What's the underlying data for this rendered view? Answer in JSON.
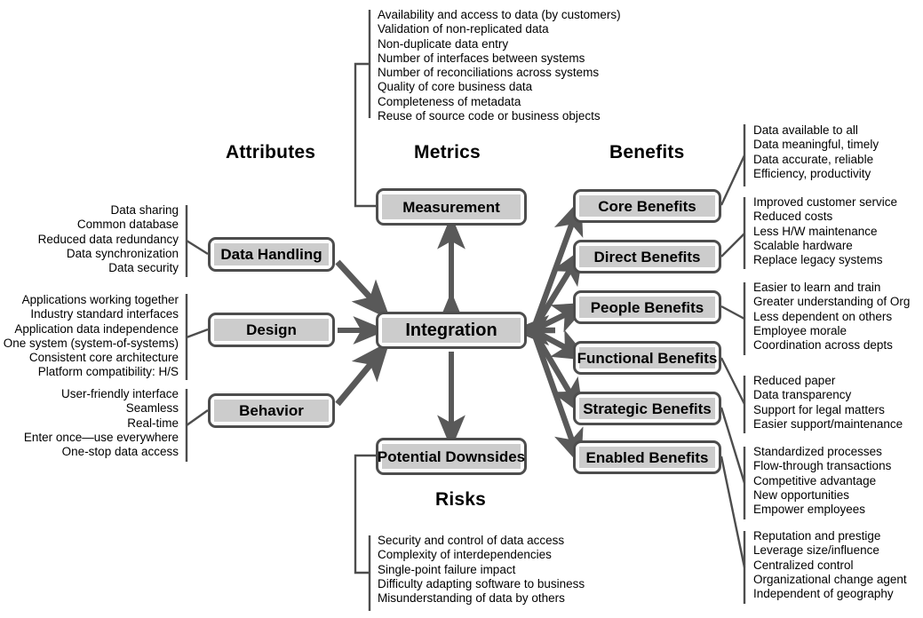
{
  "diagram": {
    "title": "Integration attributes, metrics, benefits, risks diagram",
    "colors": {
      "box_border": "#4d4d4d",
      "box_fill": "#cccccc",
      "connector": "#4d4d4d",
      "arrow": "#595959",
      "text": "#000000",
      "background": "#ffffff"
    }
  },
  "headings": {
    "attributes": "Attributes",
    "metrics": "Metrics",
    "benefits": "Benefits",
    "risks": "Risks"
  },
  "nodes": {
    "integration": "Integration",
    "measurement": "Measurement",
    "potential_downsides": "Potential Downsides",
    "data_handling": "Data Handling",
    "design": "Design",
    "behavior": "Behavior",
    "core_benefits": "Core Benefits",
    "direct_benefits": "Direct Benefits",
    "people_benefits": "People Benefits",
    "functional_benefits": "Functional Benefits",
    "strategic_benefits": "Strategic Benefits",
    "enabled_benefits": "Enabled Benefits"
  },
  "lists": {
    "metrics": [
      "Availability and access to data (by customers)",
      "Validation of non-replicated data",
      "Non-duplicate data entry",
      "Number of interfaces between systems",
      "Number of reconciliations across systems",
      "Quality of core business data",
      "Completeness of metadata",
      "Reuse of source code or business objects"
    ],
    "data_handling": [
      "Data sharing",
      "Common database",
      "Reduced data redundancy",
      "Data synchronization",
      "Data security"
    ],
    "design": [
      "Applications working together",
      "Industry standard interfaces",
      "Application data independence",
      "One system (system-of-systems)",
      "Consistent core architecture",
      "Platform compatibility: H/S"
    ],
    "behavior": [
      "User-friendly interface",
      "Seamless",
      "Real-time",
      "Enter once—use everywhere",
      "One-stop data access"
    ],
    "core_benefits": [
      "Data available to all",
      "Data meaningful, timely",
      "Data accurate, reliable",
      "Efficiency, productivity"
    ],
    "direct_benefits": [
      "Improved customer service",
      "Reduced costs",
      "Less H/W maintenance",
      "Scalable hardware",
      "Replace legacy systems"
    ],
    "people_benefits": [
      "Easier to learn and train",
      "Greater understanding of Org",
      "Less dependent on others",
      "Employee morale",
      "Coordination across depts"
    ],
    "functional_benefits": [
      "Reduced paper",
      "Data transparency",
      "Support for legal matters",
      "Easier support/maintenance"
    ],
    "strategic_benefits": [
      "Standardized processes",
      "Flow-through transactions",
      "Competitive advantage",
      "New opportunities",
      "Empower employees"
    ],
    "enabled_benefits": [
      "Reputation and prestige",
      "Leverage size/influence",
      "Centralized control",
      "Organizational change agent",
      "Independent of geography"
    ],
    "risks": [
      "Security and control of data access",
      "Complexity of interdependencies",
      "Single-point failure impact",
      "Difficulty adapting software to business",
      "Misunderstanding of data by others"
    ]
  }
}
